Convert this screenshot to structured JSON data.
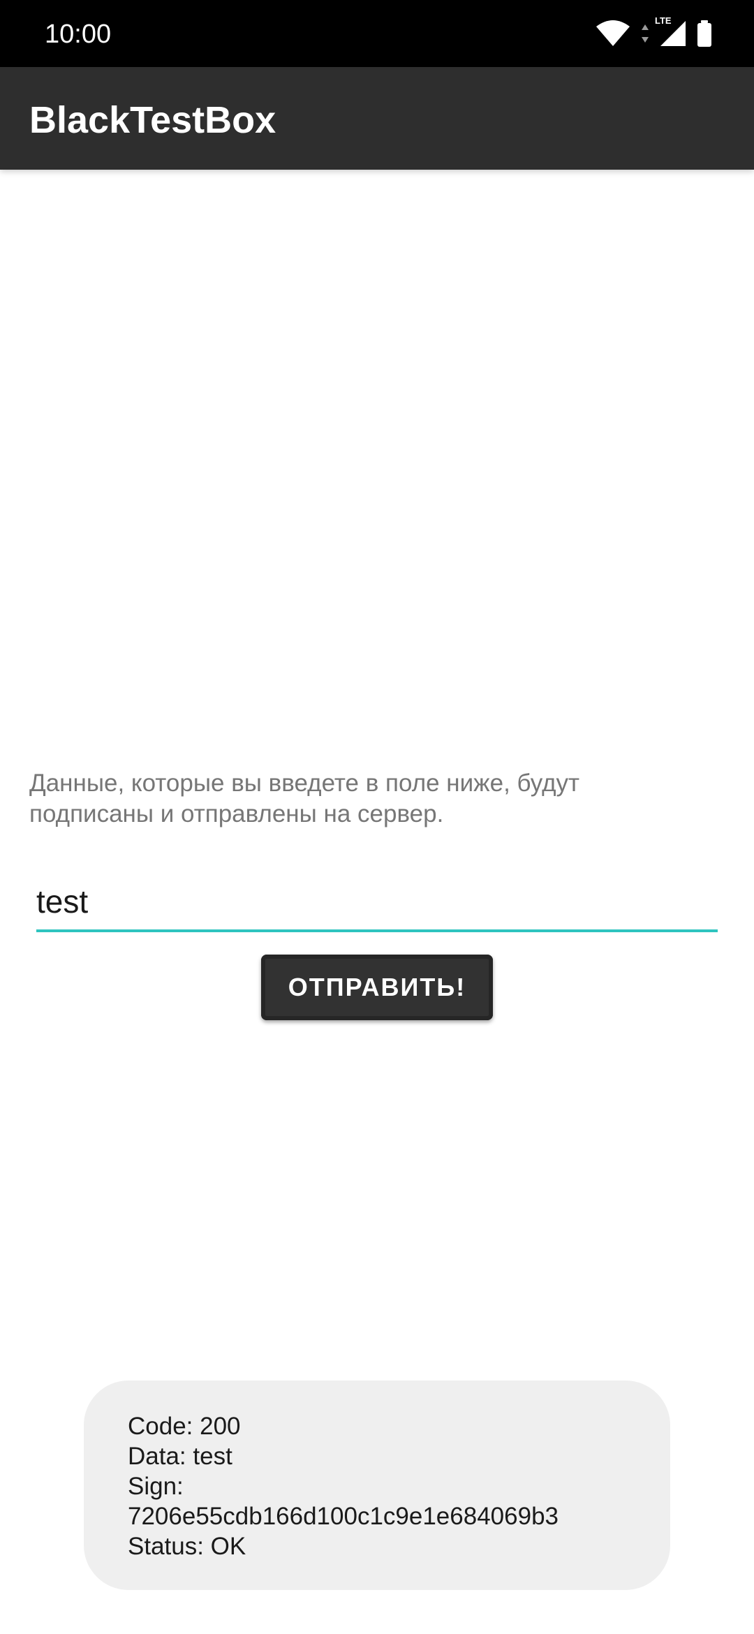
{
  "status_bar": {
    "time": "10:00",
    "network_label": "LTE",
    "icons": [
      "wifi-icon",
      "signal-icon",
      "battery-icon"
    ]
  },
  "app_bar": {
    "title": "BlackTestBox"
  },
  "main": {
    "hint_line1": "Данные, которые вы введете в поле ниже, будут",
    "hint_line2": "подписаны и отправлены на сервер.",
    "input_value": "test",
    "send_button_label": "ОТПРАВИТЬ!"
  },
  "toast": {
    "code_line": "Code: 200",
    "data_line": "Data: test",
    "sign_label": "Sign:",
    "sign_value": "7206e55cdb166d100c1c9e1e684069b3",
    "status_line": "Status: OK"
  },
  "colors": {
    "app_bar": "#2e2e2e",
    "status_bar": "#000000",
    "accent": "#2ec4bf",
    "button": "#323232",
    "toast_bg": "#efefef"
  }
}
